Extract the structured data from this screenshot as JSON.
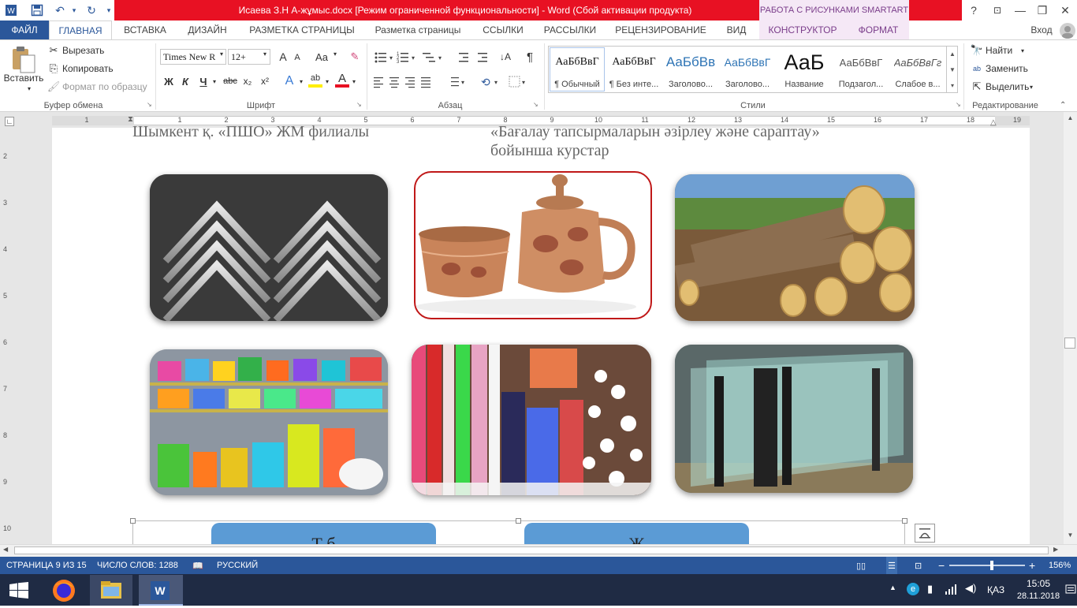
{
  "window": {
    "title": "Исаева З.Н   А-жұмыс.docx [Режим ограниченной функциональности] -  Word (Сбой активации продукта)",
    "context_tool": "РАБОТА С РИСУНКАМИ SMARTART",
    "help": "?",
    "minimize": "—",
    "restore": "❐",
    "close": "✕",
    "ribbon_display": "⊡"
  },
  "qat": {
    "save": "🖫",
    "undo": "↶",
    "undo_arrow": "▾",
    "redo": "↻",
    "customize": "▾"
  },
  "tabs": [
    "ФАЙЛ",
    "ГЛАВНАЯ",
    "ВСТАВКА",
    "ДИЗАЙН",
    "РАЗМЕТКА СТРАНИЦЫ",
    "Разметка страницы",
    "ССЫЛКИ",
    "РАССЫЛКИ",
    "РЕЦЕНЗИРОВАНИЕ",
    "ВИД",
    "КОНСТРУКТОР",
    "ФОРМАТ"
  ],
  "signin": "Вход",
  "clipboard": {
    "paste": "Вставить",
    "cut": "Вырезать",
    "copy": "Копировать",
    "format_painter": "Формат по образцу",
    "label": "Буфер обмена"
  },
  "font": {
    "name": "Times New R",
    "size": "12+",
    "grow": "A",
    "shrink": "A",
    "case": "Aa",
    "bold": "Ж",
    "italic": "К",
    "underline": "Ч",
    "strike": "abc",
    "subscript": "x₂",
    "superscript": "x²",
    "effects": "A",
    "highlight": "ab",
    "color": "A",
    "label": "Шрифт"
  },
  "paragraph": {
    "label": "Абзац",
    "pilcrow": "¶",
    "sort": "↓A"
  },
  "styles": {
    "label": "Стили",
    "items": [
      {
        "preview": "АаБбВвГ",
        "name": "¶ Обычный"
      },
      {
        "preview": "АаБбВвГ",
        "name": "¶ Без инте..."
      },
      {
        "preview": "АаБбВв",
        "name": "Заголово..."
      },
      {
        "preview": "АаБбВвГ",
        "name": "Заголово..."
      },
      {
        "preview": "АаБ",
        "name": "Название"
      },
      {
        "preview": "АаБбВвГ",
        "name": "Подзагол..."
      },
      {
        "preview": "АаБбВвГг",
        "name": "Слабое в..."
      }
    ]
  },
  "editing": {
    "label": "Редактирование",
    "find": "Найти",
    "replace": "Заменить",
    "select": "Выделить"
  },
  "ruler": {
    "numbers": [
      "1",
      "2",
      "1",
      "2",
      "3",
      "4",
      "5",
      "6",
      "7",
      "8",
      "9",
      "10",
      "11",
      "12",
      "13",
      "14",
      "15",
      "16",
      "17",
      "18",
      "19"
    ],
    "vnumbers": [
      "2",
      "3",
      "4",
      "5",
      "6",
      "7",
      "8",
      "9",
      "10"
    ]
  },
  "document": {
    "line1_left": "Шымкент қ. «ПШО» ЖМ филиалы",
    "line1_right": "«Бағалау тапсырмаларын әзірлеу және сараптау»",
    "line2_right": "бойынша курстар",
    "smartart_left": "Т б",
    "smartart_right": "Ж"
  },
  "status": {
    "page": "СТРАНИЦА 9 ИЗ 15",
    "words": "ЧИСЛО СЛОВ: 1288",
    "lang": "РУССКИЙ",
    "zoom": "156%",
    "zoom_fraction": 0.56
  },
  "taskbar": {
    "lang": "ҚАЗ",
    "time": "15:05",
    "date": "28.11.2018"
  },
  "colors": {
    "word_blue": "#2b579a",
    "title_red": "#e81123",
    "smartart_blue": "#5b9bd5"
  }
}
